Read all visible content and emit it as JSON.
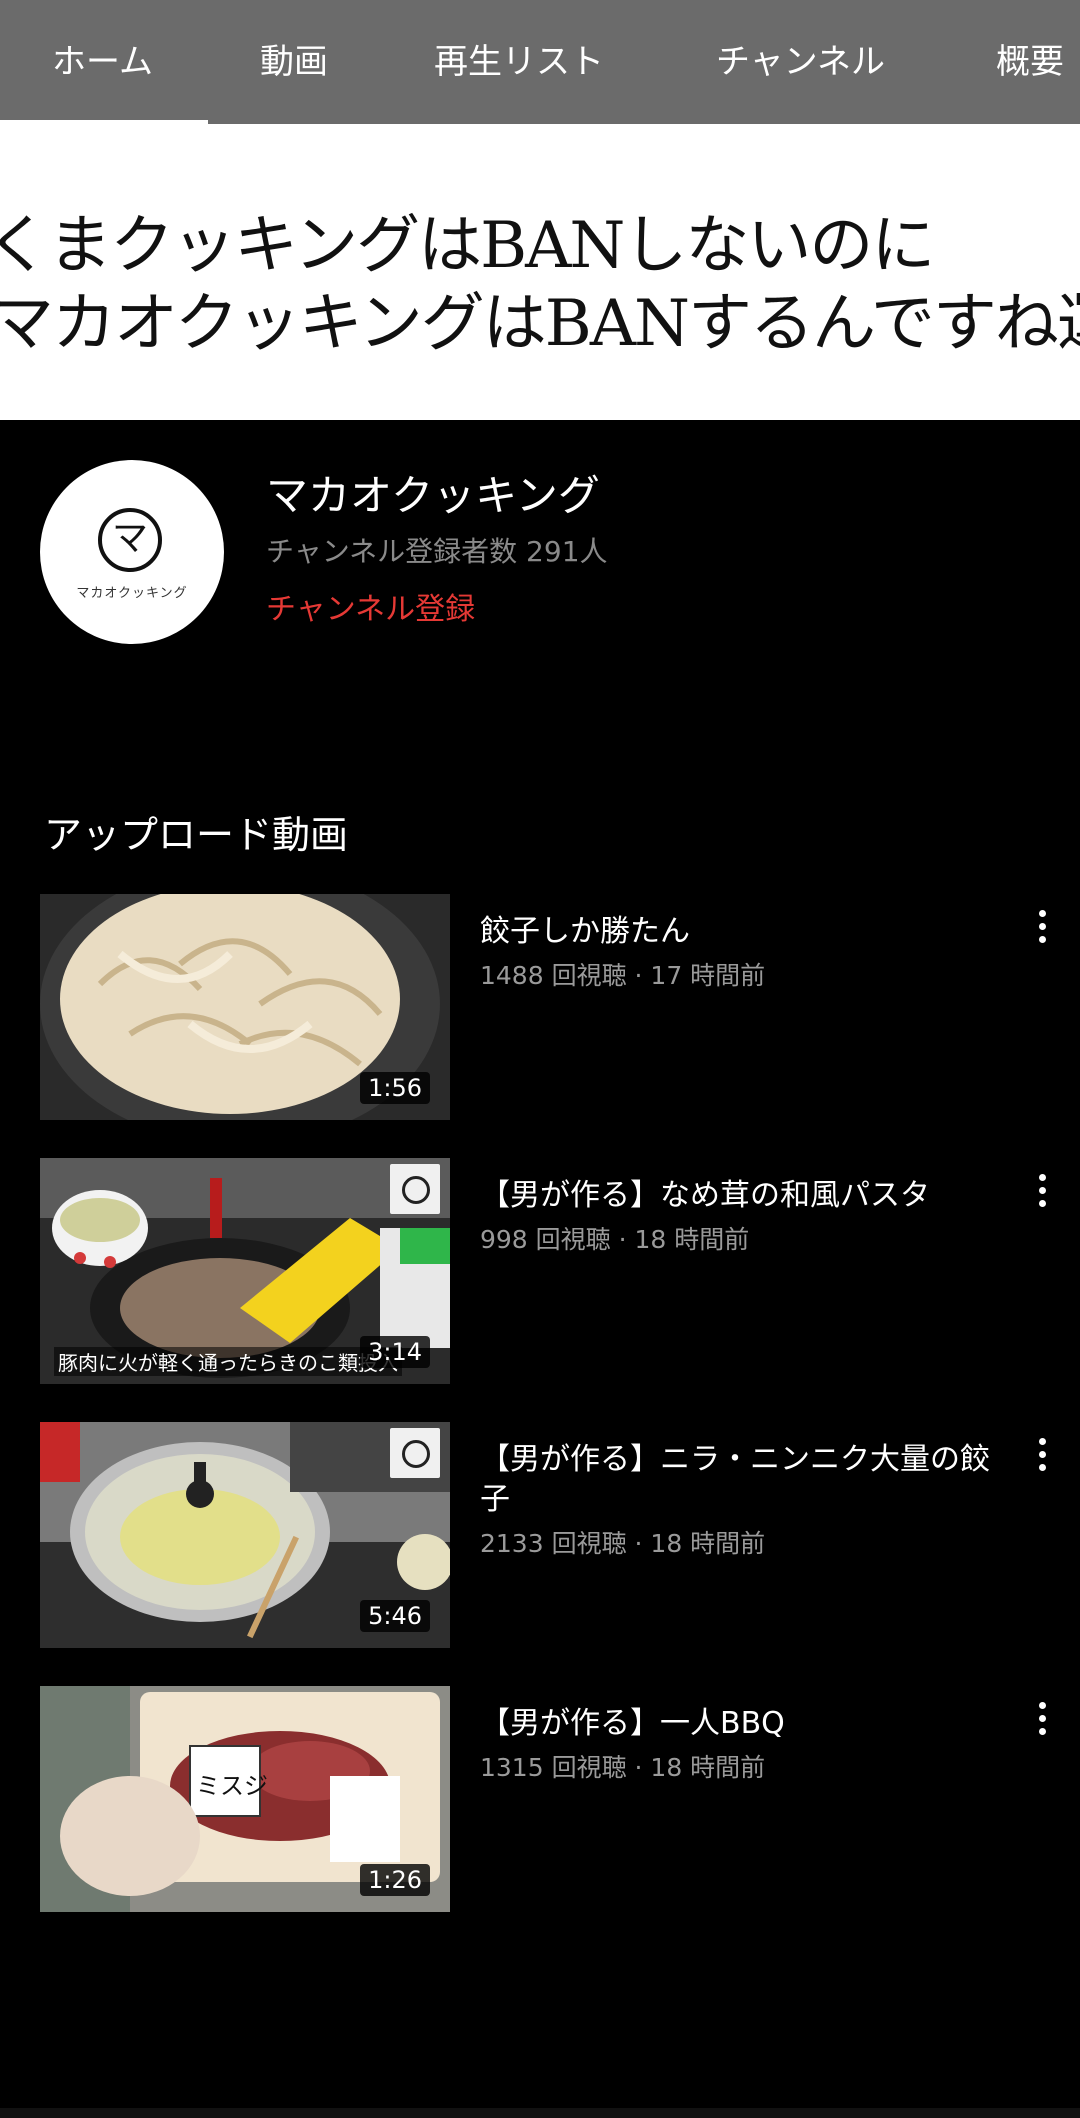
{
  "tabs": [
    {
      "label": "ホーム",
      "active": true
    },
    {
      "label": "動画"
    },
    {
      "label": "再生リスト"
    },
    {
      "label": "チャンネル"
    },
    {
      "label": "概要"
    }
  ],
  "banner": {
    "line1": "くまクッキングはBANしないのに",
    "line2": "マカオクッキングはBANするんですね運営さん"
  },
  "channel": {
    "avatar_text": "マカオクッキング",
    "avatar_mark": "マ",
    "name": "マカオクッキング",
    "subscribers": "チャンネル登録者数 291人",
    "subscribe_label": "チャンネル登録"
  },
  "section": {
    "title": "アップロード動画"
  },
  "videos": [
    {
      "title": "餃子しか勝たん",
      "meta": "1488 回視聴 · 17 時間前",
      "duration": "1:56"
    },
    {
      "title": "【男が作る】なめ茸の和風パスタ",
      "meta": "998 回視聴 · 18 時間前",
      "duration": "3:14",
      "caption": "豚肉に火が軽く通ったらきのこ類投入"
    },
    {
      "title": "【男が作る】ニラ・ニンニク大量の餃子",
      "meta": "2133 回視聴 · 18 時間前",
      "duration": "5:46"
    },
    {
      "title": "【男が作る】一人BBQ",
      "meta": "1315 回視聴 · 18 時間前",
      "duration": "1:26",
      "label_text": "ミスジ"
    }
  ],
  "colors": {
    "tabbar": "#6b6b6b",
    "accent_red": "#e53935",
    "meta_gray": "#9a9a9a"
  }
}
